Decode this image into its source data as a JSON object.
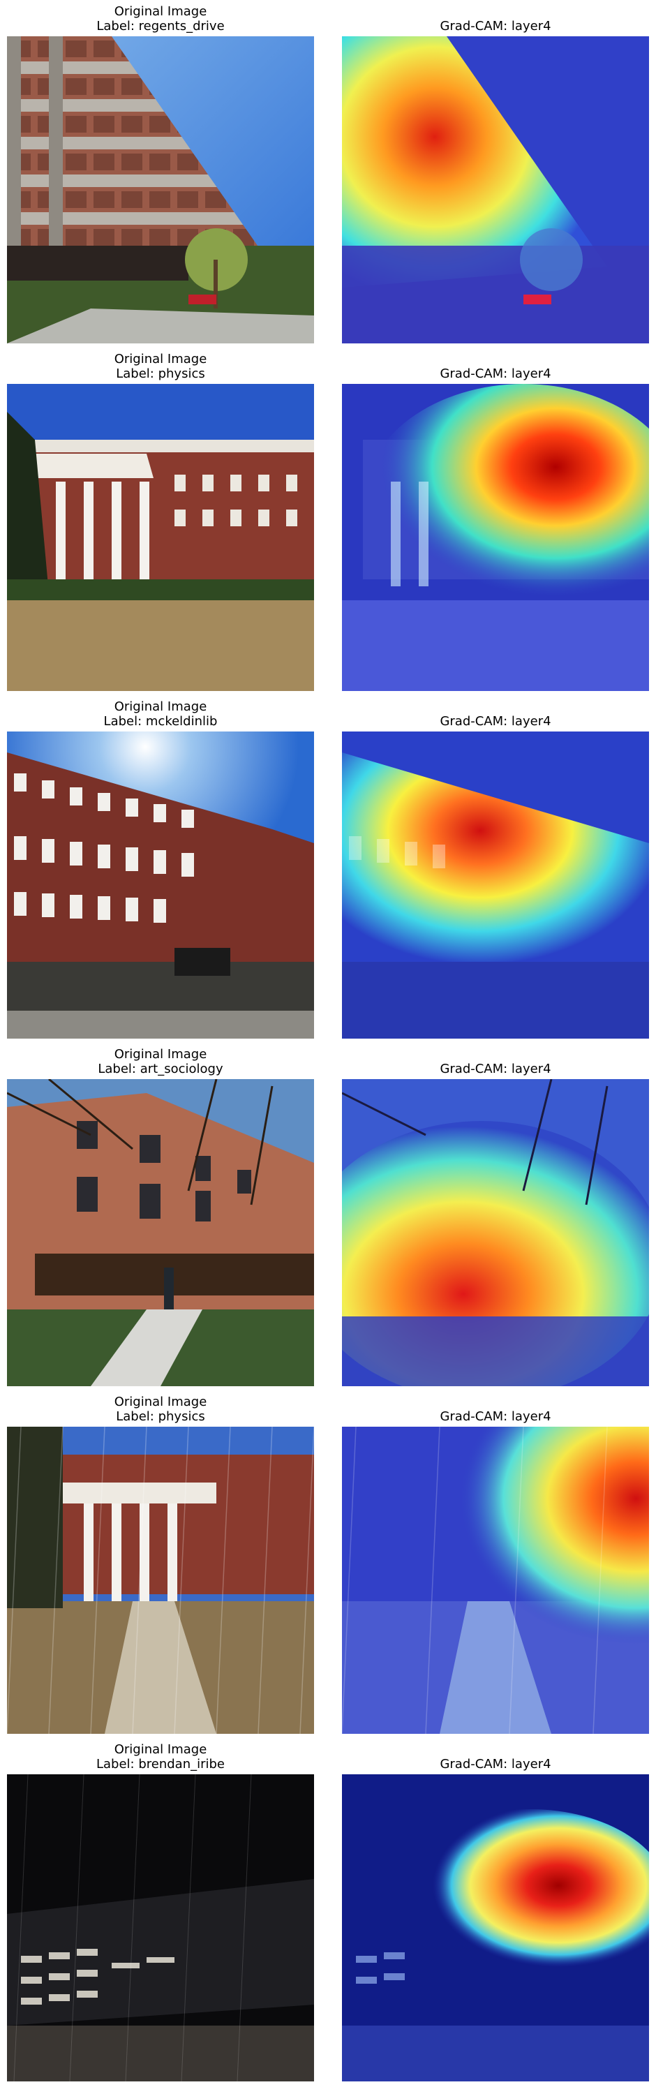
{
  "figure": {
    "rows": [
      {
        "original": {
          "title": "Original Image",
          "label": "Label: regents_drive"
        },
        "cam": {
          "title": "Grad-CAM: layer4"
        }
      },
      {
        "original": {
          "title": "Original Image",
          "label": "Label: physics"
        },
        "cam": {
          "title": "Grad-CAM: layer4"
        }
      },
      {
        "original": {
          "title": "Original Image",
          "label": "Label: mckeldinlib"
        },
        "cam": {
          "title": "Grad-CAM: layer4"
        }
      },
      {
        "original": {
          "title": "Original Image",
          "label": "Label: art_sociology"
        },
        "cam": {
          "title": "Grad-CAM: layer4"
        }
      },
      {
        "original": {
          "title": "Original Image",
          "label": "Label: physics"
        },
        "cam": {
          "title": "Grad-CAM: layer4"
        }
      },
      {
        "original": {
          "title": "Original Image",
          "label": "Label: brendan_iribe"
        },
        "cam": {
          "title": "Grad-CAM: layer4"
        }
      }
    ]
  }
}
